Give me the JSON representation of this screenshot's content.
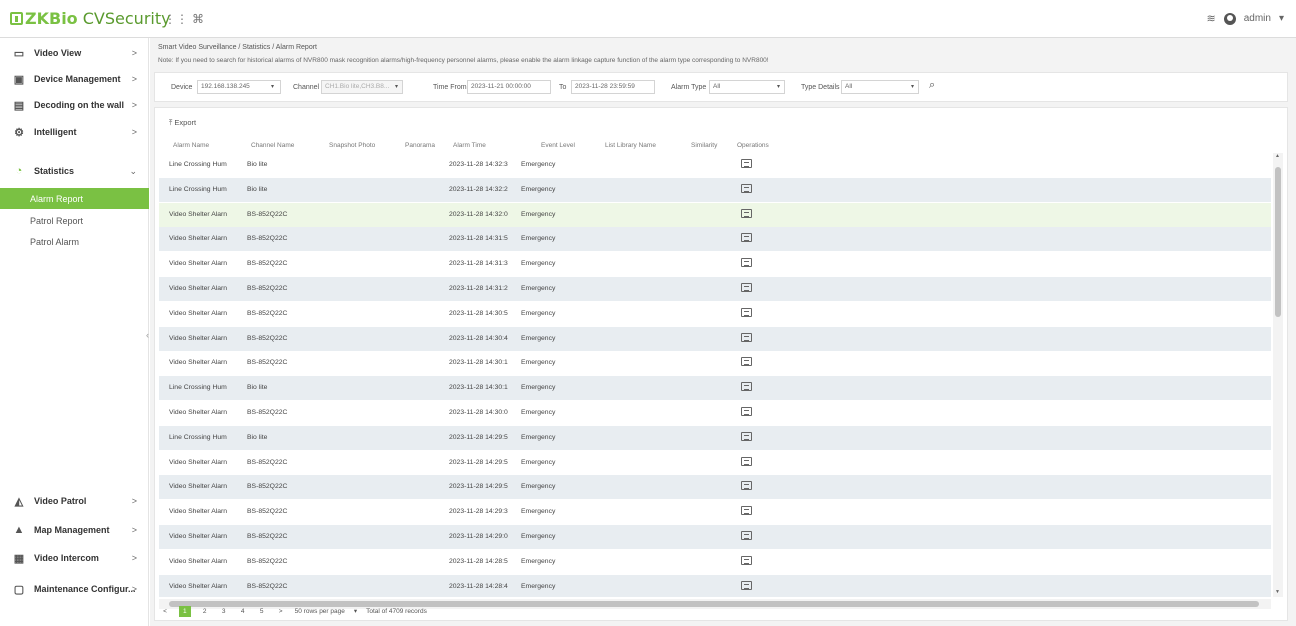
{
  "app": {
    "logo_prefix": "ZK",
    "logo_bio": "Bio",
    "logo_rest": " CVSecurity"
  },
  "topbar": {
    "grid_icon": "grid-icon",
    "expand_icon": "expand-icon",
    "notify_icon": "layers-icon",
    "user": "admin",
    "user_caret": "▾"
  },
  "sidebar": {
    "items": [
      {
        "label": "Video View",
        "icon": "video-view-icon",
        "glyph": "▭",
        "chev": ">"
      },
      {
        "label": "Device Management",
        "icon": "device-icon",
        "glyph": "▣",
        "chev": ">"
      },
      {
        "label": "Decoding on the wall",
        "icon": "decode-wall-icon",
        "glyph": "▤",
        "chev": ">"
      },
      {
        "label": "Intelligent",
        "icon": "intelligent-icon",
        "glyph": "⚙",
        "chev": ">"
      },
      {
        "label": "Statistics",
        "icon": "statistics-icon",
        "glyph": "◔",
        "chev": "⌄"
      }
    ],
    "sub_items": [
      {
        "label": "Alarm Report",
        "active": true
      },
      {
        "label": "Patrol Report",
        "active": false
      },
      {
        "label": "Patrol Alarm",
        "active": false
      }
    ],
    "bottom_items": [
      {
        "label": "Video Patrol",
        "icon": "video-patrol-icon",
        "glyph": "◭",
        "chev": ">"
      },
      {
        "label": "Map Management",
        "icon": "map-icon",
        "glyph": "▲",
        "chev": ">"
      },
      {
        "label": "Video Intercom",
        "icon": "intercom-icon",
        "glyph": "▦",
        "chev": ">"
      },
      {
        "label": "Maintenance Configur...",
        "icon": "maintenance-icon",
        "glyph": "▢",
        "chev": ">"
      }
    ]
  },
  "breadcrumb": "Smart Video Surveillance / Statistics / Alarm Report",
  "note": "Note: If you need to search for historical alarms of NVR800 mask recognition alarms/high-frequency personnel alarms, please enable the alarm linkage capture function of the alarm type corresponding to NVR800!",
  "filters": {
    "device_label": "Device",
    "device_value": "192.168.138.245",
    "channel_label": "Channel",
    "channel_value": "CH1.Bio lite,CH3.B8...",
    "time_from_label": "Time From",
    "time_from_value": "2023-11-21 00:00:00",
    "to_label": "To",
    "to_value": "2023-11-28 23:59:59",
    "alarm_type_label": "Alarm Type",
    "alarm_type_value": "All",
    "type_details_label": "Type Details",
    "type_details_value": "All"
  },
  "export_label": "Export",
  "table": {
    "columns": [
      "Alarm Name",
      "Channel Name",
      "Snapshot Photo",
      "Panorama",
      "Alarm Time",
      "Event Level",
      "List Library Name",
      "Similarity",
      "Operations"
    ],
    "rows": [
      {
        "name": "Line Crossing Hum",
        "channel": "Bio lite",
        "time": "2023-11-28 14:32:3",
        "level": "Emergency"
      },
      {
        "name": "Line Crossing Hum",
        "channel": "Bio lite",
        "time": "2023-11-28 14:32:2",
        "level": "Emergency"
      },
      {
        "name": "Video Shelter Alarn",
        "channel": "BS-852Q22C",
        "time": "2023-11-28 14:32:0",
        "level": "Emergency"
      },
      {
        "name": "Video Shelter Alarn",
        "channel": "BS-852Q22C",
        "time": "2023-11-28 14:31:5",
        "level": "Emergency"
      },
      {
        "name": "Video Shelter Alarn",
        "channel": "BS-852Q22C",
        "time": "2023-11-28 14:31:3",
        "level": "Emergency"
      },
      {
        "name": "Video Shelter Alarn",
        "channel": "BS-852Q22C",
        "time": "2023-11-28 14:31:2",
        "level": "Emergency"
      },
      {
        "name": "Video Shelter Alarn",
        "channel": "BS-852Q22C",
        "time": "2023-11-28 14:30:5",
        "level": "Emergency"
      },
      {
        "name": "Video Shelter Alarn",
        "channel": "BS-852Q22C",
        "time": "2023-11-28 14:30:4",
        "level": "Emergency"
      },
      {
        "name": "Video Shelter Alarn",
        "channel": "BS-852Q22C",
        "time": "2023-11-28 14:30:1",
        "level": "Emergency"
      },
      {
        "name": "Line Crossing Hum",
        "channel": "Bio lite",
        "time": "2023-11-28 14:30:1",
        "level": "Emergency"
      },
      {
        "name": "Video Shelter Alarn",
        "channel": "BS-852Q22C",
        "time": "2023-11-28 14:30:0",
        "level": "Emergency"
      },
      {
        "name": "Line Crossing Hum",
        "channel": "Bio lite",
        "time": "2023-11-28 14:29:5",
        "level": "Emergency"
      },
      {
        "name": "Video Shelter Alarn",
        "channel": "BS-852Q22C",
        "time": "2023-11-28 14:29:5",
        "level": "Emergency"
      },
      {
        "name": "Video Shelter Alarn",
        "channel": "BS-852Q22C",
        "time": "2023-11-28 14:29:5",
        "level": "Emergency"
      },
      {
        "name": "Video Shelter Alarn",
        "channel": "BS-852Q22C",
        "time": "2023-11-28 14:29:3",
        "level": "Emergency"
      },
      {
        "name": "Video Shelter Alarn",
        "channel": "BS-852Q22C",
        "time": "2023-11-28 14:29:0",
        "level": "Emergency"
      },
      {
        "name": "Video Shelter Alarn",
        "channel": "BS-852Q22C",
        "time": "2023-11-28 14:28:5",
        "level": "Emergency"
      },
      {
        "name": "Video Shelter Alarn",
        "channel": "BS-852Q22C",
        "time": "2023-11-28 14:28:4",
        "level": "Emergency"
      },
      {
        "name": "",
        "channel": "",
        "time": "",
        "level": ""
      }
    ]
  },
  "pager": {
    "prev": "<",
    "pages": [
      "1",
      "2",
      "3",
      "4",
      "5"
    ],
    "next": ">",
    "per_page": "50 rows per page",
    "total": "Total of 4709 records"
  },
  "colors": {
    "accent": "#7ac143",
    "row_alt": "#e8edf1",
    "row_highlight": "#eef7e6"
  }
}
